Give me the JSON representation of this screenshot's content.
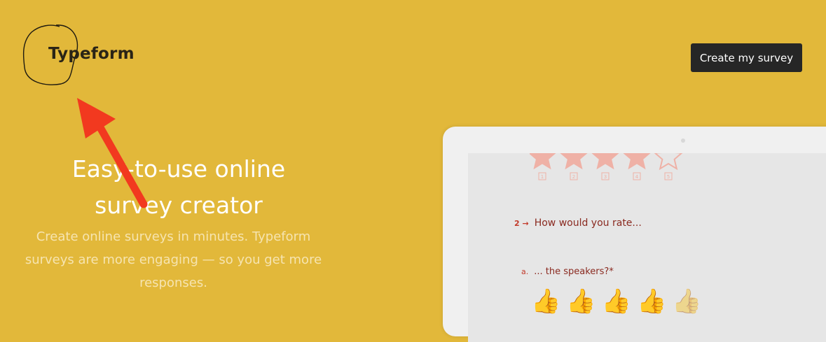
{
  "brand": {
    "name": "Typeform"
  },
  "header": {
    "cta_label": "Create my survey"
  },
  "hero": {
    "title_line1": "Easy-to-use online",
    "title_line2": "survey creator",
    "subtitle": "Create online surveys in minutes. Typeform surveys are more engaging — so you get more responses."
  },
  "preview": {
    "star_rating": 4,
    "star_max": 5,
    "star_labels": [
      "1",
      "2",
      "3",
      "4",
      "5"
    ],
    "question_number": "2",
    "question_text": "How would you rate...",
    "sub_letter": "a.",
    "sub_text": "... the speakers?*",
    "thumb_rating": 4,
    "thumb_max": 5
  },
  "colors": {
    "background": "#e2b83a",
    "cta_bg": "#262626",
    "accent_red": "#e54a2a",
    "annotation_arrow": "#f2391f"
  },
  "annotations": [
    "circle-around-logo",
    "arrow-pointing-to-logo"
  ]
}
